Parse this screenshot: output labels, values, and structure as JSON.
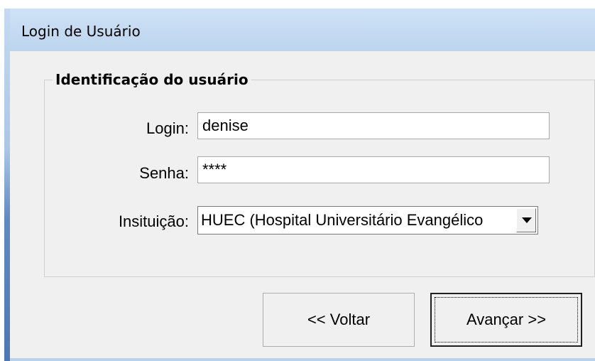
{
  "window": {
    "title": "Login de Usuário"
  },
  "group": {
    "legend": "Identificação do usuário"
  },
  "form": {
    "login_label": "Login:",
    "login_value": "denise",
    "password_label": "Senha:",
    "password_value": "****",
    "institution_label": "Insituição:",
    "institution_value": "HUEC (Hospital Universitário Evangélico"
  },
  "buttons": {
    "back_label": "<< Voltar",
    "next_label": "Avançar >>"
  },
  "colors": {
    "titlebar": "#bcd4ee",
    "client": "#f0f0f0"
  },
  "icons": {
    "dropdown": "triangle-down-icon"
  }
}
